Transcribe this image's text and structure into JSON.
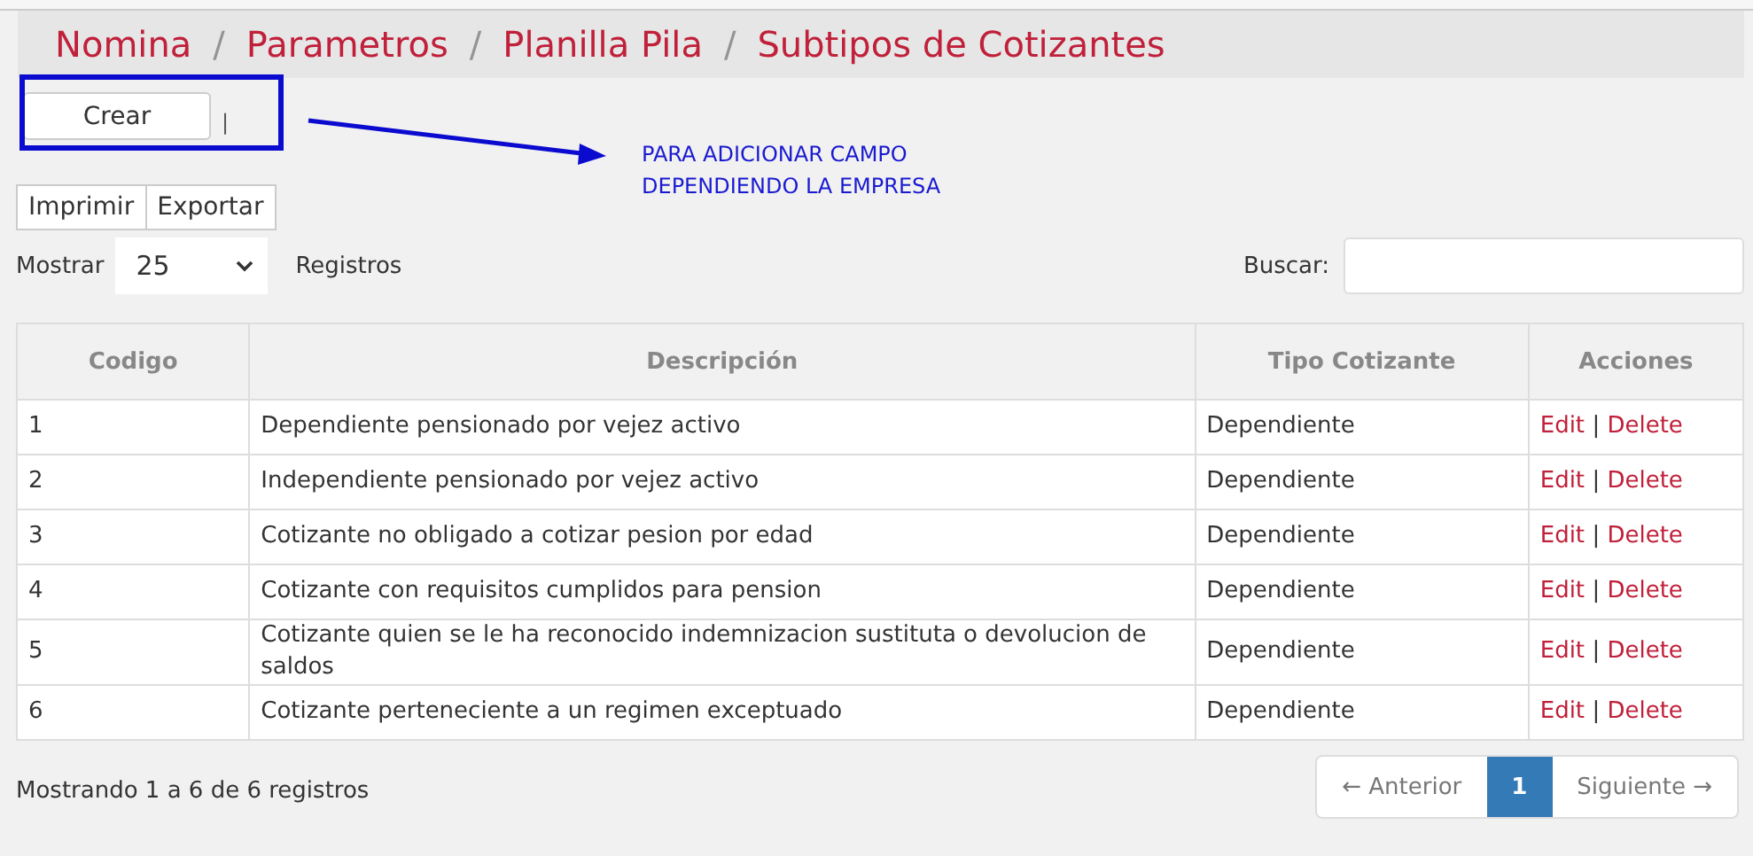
{
  "breadcrumb": [
    "Nomina",
    "Parametros",
    "Planilla Pila",
    "Subtipos de Cotizantes"
  ],
  "breadcrumb_separator": "/",
  "create_button": "Crear",
  "cursor_mark": "|",
  "annotation": {
    "lines": [
      "PARA ADICIONAR CAMPO",
      "DEPENDIENDO LA EMPRESA"
    ]
  },
  "export_buttons": [
    "Imprimir",
    "Exportar"
  ],
  "length": {
    "label": "Mostrar",
    "value": "25",
    "suffix": "Registros"
  },
  "search": {
    "label": "Buscar:"
  },
  "table": {
    "columns": [
      "Codigo",
      "Descripción",
      "Tipo Cotizante",
      "Acciones"
    ],
    "rows": [
      {
        "code": "1",
        "description": "Dependiente pensionado por vejez activo",
        "type": "Dependiente",
        "edit": "Edit",
        "sep": "|",
        "delete": "Delete"
      },
      {
        "code": "2",
        "description": "Independiente pensionado por vejez activo",
        "type": "Dependiente",
        "edit": "Edit",
        "sep": "|",
        "delete": "Delete"
      },
      {
        "code": "3",
        "description": "Cotizante no obligado a cotizar pesion por edad",
        "type": "Dependiente",
        "edit": "Edit",
        "sep": "|",
        "delete": "Delete"
      },
      {
        "code": "4",
        "description": "Cotizante con requisitos cumplidos para pension",
        "type": "Dependiente",
        "edit": "Edit",
        "sep": "|",
        "delete": "Delete"
      },
      {
        "code": "5",
        "description": "Cotizante quien se le ha reconocido indemnizacion sustituta o devolucion de saldos",
        "type": "Dependiente",
        "edit": "Edit",
        "sep": "|",
        "delete": "Delete"
      },
      {
        "code": "6",
        "description": "Cotizante perteneciente a un regimen exceptuado",
        "type": "Dependiente",
        "edit": "Edit",
        "sep": "|",
        "delete": "Delete"
      }
    ]
  },
  "info": "Mostrando 1 a 6 de 6 registros",
  "pagination": {
    "previous": "← Anterior",
    "pages": [
      {
        "label": "1",
        "selected": true
      }
    ],
    "next": "Siguiente →"
  }
}
